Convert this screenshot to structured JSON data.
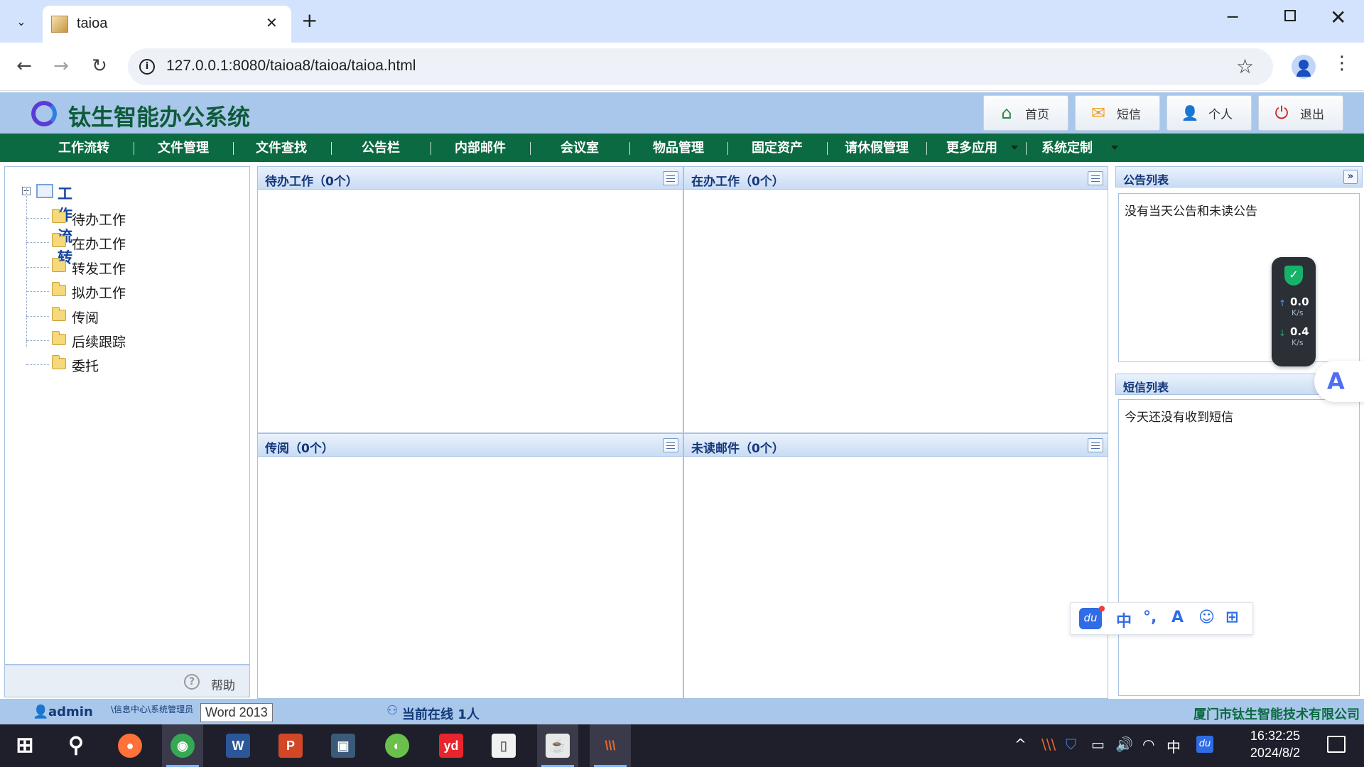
{
  "browser": {
    "tab_title": "taioa",
    "url": "127.0.0.1:8080/taioa8/taioa/taioa.html",
    "window_controls": {
      "minimize": "─",
      "close": "✕"
    },
    "new_tab": "+",
    "tab_close": "✕",
    "nav": {
      "back": "←",
      "forward": "→",
      "reload": "↻"
    },
    "icons": {
      "info": "i",
      "star": "☆",
      "menu": "⋮",
      "tab_list": "⌄"
    }
  },
  "app": {
    "title": "钛生智能办公系统",
    "header_buttons": [
      {
        "label": "首页",
        "icon": "home-icon",
        "glyph": "⌂",
        "color": "#1e8a3c"
      },
      {
        "label": "短信",
        "icon": "message-icon",
        "glyph": "✉",
        "color": "#f0a020"
      },
      {
        "label": "个人",
        "icon": "user-icon",
        "glyph": "👤",
        "color": "#2f9a5a"
      },
      {
        "label": "退出",
        "icon": "power-icon",
        "glyph": "⏻",
        "color": "#d42020"
      }
    ],
    "menu": [
      {
        "label": "工作流转"
      },
      {
        "label": "文件管理"
      },
      {
        "label": "文件查找"
      },
      {
        "label": "公告栏"
      },
      {
        "label": "内部邮件"
      },
      {
        "label": "会议室"
      },
      {
        "label": "物品管理"
      },
      {
        "label": "固定资产"
      },
      {
        "label": "请休假管理"
      },
      {
        "label": "更多应用"
      },
      {
        "label": "系统定制"
      }
    ]
  },
  "tree": {
    "root": {
      "label": "工作流转",
      "toggle": "−"
    },
    "items": [
      {
        "label": "待办工作"
      },
      {
        "label": "在办工作"
      },
      {
        "label": "转发工作"
      },
      {
        "label": "拟办工作"
      },
      {
        "label": "传阅"
      },
      {
        "label": "后续跟踪"
      },
      {
        "label": "委托"
      }
    ],
    "help_label": "帮助",
    "help_icon": "?"
  },
  "portlets": [
    {
      "title": "待办工作（0个）"
    },
    {
      "title": "在办工作（0个）"
    },
    {
      "title": "传阅（0个）"
    },
    {
      "title": "未读邮件（0个）"
    }
  ],
  "right_panel": {
    "collapse_glyph": "»",
    "announcements": {
      "title": "公告列表",
      "empty_text": "没有当天公告和未读公告"
    },
    "messages": {
      "title": "短信列表",
      "empty_text": "今天还没有收到短信"
    }
  },
  "speed_widget": {
    "shield": "✓",
    "upload": {
      "arrow": "↑",
      "value": "0.0",
      "unit": "K/s",
      "color": "#4aa3ff"
    },
    "download": {
      "arrow": "↓",
      "value": "0.4",
      "unit": "K/s",
      "color": "#17b26a"
    }
  },
  "assistant_glyph": "A",
  "ime": {
    "logo": "du",
    "chars": [
      "中",
      "°,",
      "A",
      "☺",
      "⊞"
    ]
  },
  "status": {
    "user_icon": "👤",
    "username": "admin",
    "department": "\\信息中心\\系统管理员",
    "tooltip": "Word 2013",
    "online_icon": "⚇",
    "online": "当前在线 1人",
    "company": "厦门市钛生智能技术有限公司"
  },
  "taskbar": {
    "items": [
      {
        "name": "windows-start-icon",
        "glyph": "⊞",
        "bg": "transparent"
      },
      {
        "name": "search-icon",
        "glyph": "⚲",
        "bg": "transparent"
      },
      {
        "name": "firefox-icon",
        "glyph": "●",
        "bg": "#ff7139"
      },
      {
        "name": "chrome-icon",
        "glyph": "◉",
        "bg": "#34a853",
        "active": true
      },
      {
        "name": "word-icon",
        "glyph": "W",
        "bg": "#2b579a"
      },
      {
        "name": "powerpoint-icon",
        "glyph": "P",
        "bg": "#d24726"
      },
      {
        "name": "remote-icon",
        "glyph": "▣",
        "bg": "#3b5a7a"
      },
      {
        "name": "green-app-icon",
        "glyph": "◐",
        "bg": "#6bc04b"
      },
      {
        "name": "youdao-icon",
        "glyph": "yd",
        "bg": "#e8242c"
      },
      {
        "name": "file-icon",
        "glyph": "▯",
        "bg": "#f1f1f1"
      },
      {
        "name": "java-icon",
        "glyph": "☕",
        "bg": "#e8e8e8",
        "active": true
      },
      {
        "name": "winrar-icon",
        "glyph": "\\\\\\",
        "bg": "transparent",
        "active": true
      }
    ],
    "tray": {
      "chevron": "^",
      "ime": "中",
      "volume": "🔊"
    },
    "time": "16:32:25",
    "date": "2024/8/2"
  }
}
